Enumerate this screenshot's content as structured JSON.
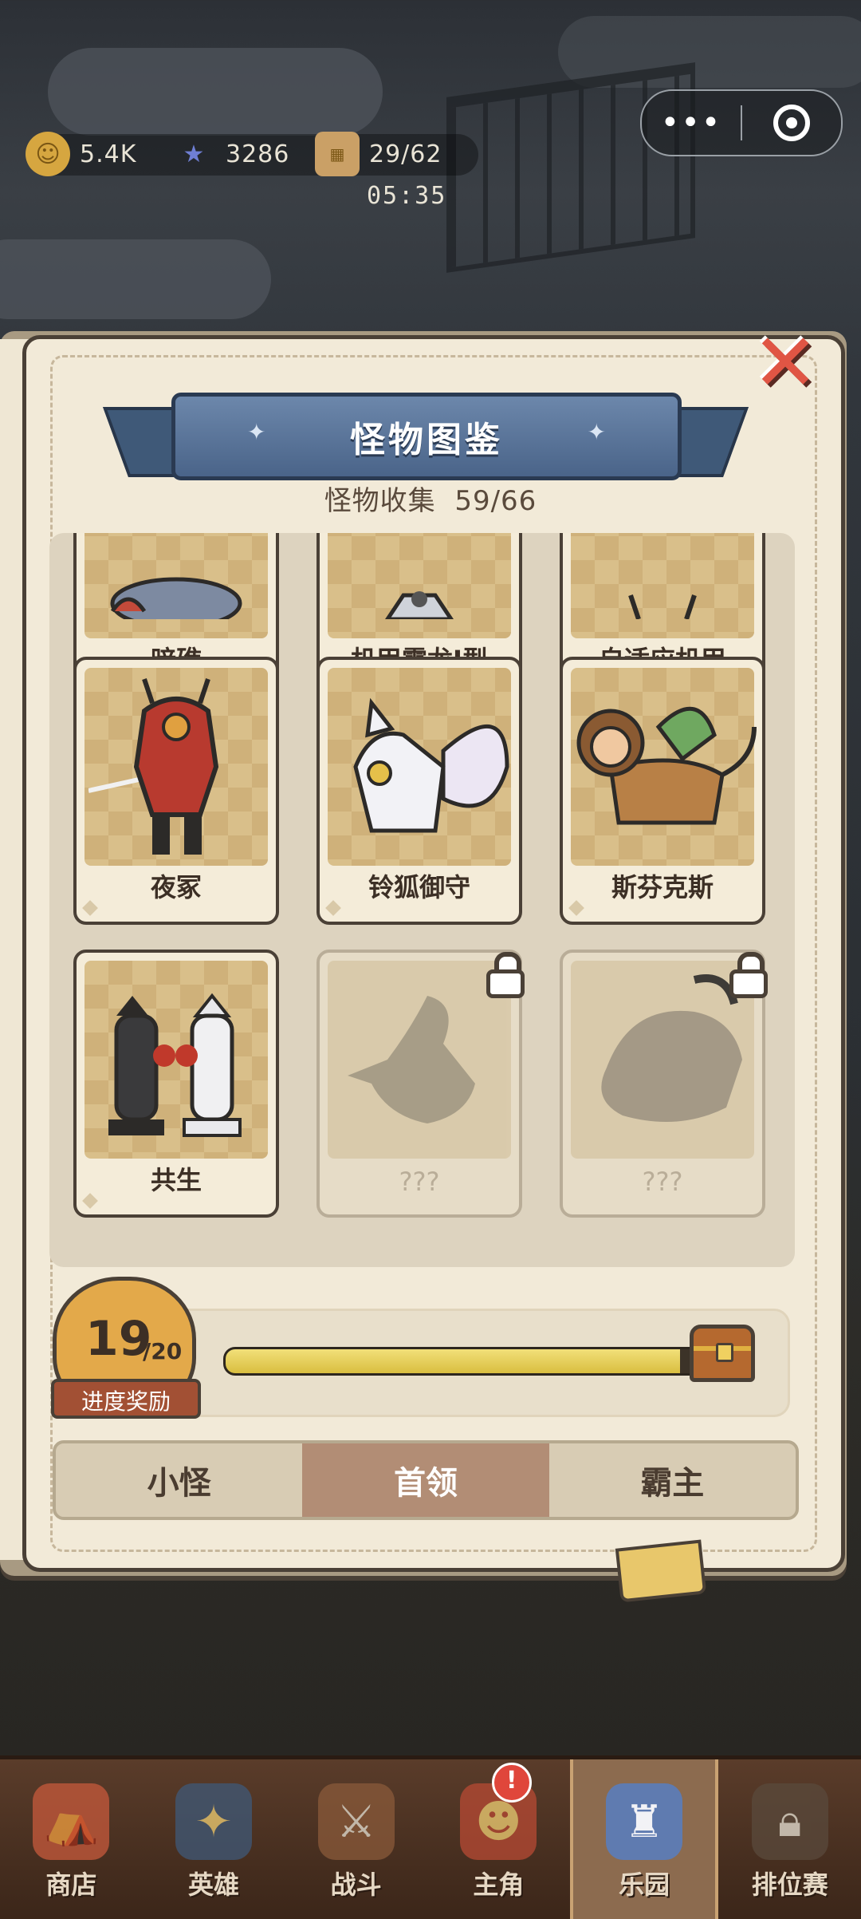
{
  "resources": {
    "coins": "5.4K",
    "gems": "3286",
    "tickets": "29/62",
    "timer": "05:35"
  },
  "capsule": {
    "more": "•••"
  },
  "book": {
    "title": "怪物图鉴",
    "collection_label": "怪物收集",
    "collection_count": "59/66",
    "close_glyph": "✕"
  },
  "cards": [
    {
      "name": "暗礁",
      "locked": false
    },
    {
      "name": "机甲霸龙I型",
      "locked": false
    },
    {
      "name": "自适应机甲",
      "locked": false
    },
    {
      "name": "夜冢",
      "locked": false
    },
    {
      "name": "铃狐御守",
      "locked": false
    },
    {
      "name": "斯芬克斯",
      "locked": false
    },
    {
      "name": "共生",
      "locked": false
    },
    {
      "name": "???",
      "locked": true
    },
    {
      "name": "???",
      "locked": true
    }
  ],
  "progress": {
    "current": "19",
    "total": "/20",
    "label": "进度奖励",
    "fraction": 0.95
  },
  "tabs": [
    {
      "label": "小怪",
      "active": false
    },
    {
      "label": "首领",
      "active": true
    },
    {
      "label": "霸主",
      "active": false
    }
  ],
  "nav": [
    {
      "label": "商店",
      "icon": "shop-icon"
    },
    {
      "label": "英雄",
      "icon": "hero-cards-icon"
    },
    {
      "label": "战斗",
      "icon": "battle-icon"
    },
    {
      "label": "主角",
      "icon": "protagonist-icon",
      "badge": "!"
    },
    {
      "label": "乐园",
      "icon": "castle-icon",
      "active": true
    },
    {
      "label": "排位赛",
      "icon": "ranked-lock-icon"
    }
  ],
  "colors": {
    "accent_gold": "#d9be3f",
    "active_tab": "#b28d75",
    "ribbon": "#4a6489",
    "close": "#e05544"
  }
}
